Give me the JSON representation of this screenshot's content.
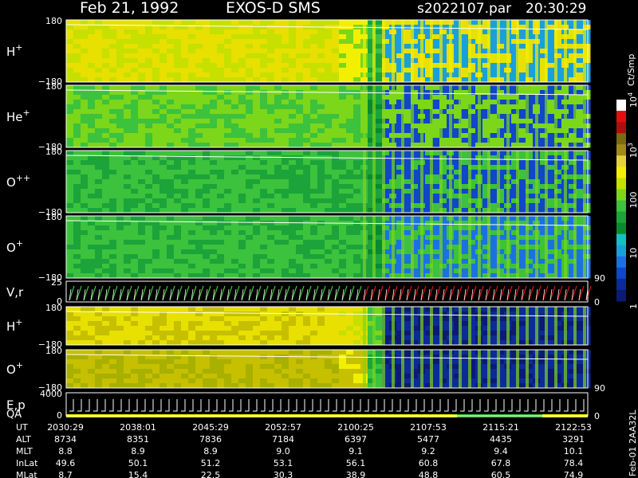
{
  "header": {
    "date": "Feb 21, 1992",
    "instrument": "EXOS-D SMS",
    "file": "s2022107.par",
    "time": "20:30:29"
  },
  "colorbar": {
    "unit_label": "Ct/Smp",
    "ticks": [
      {
        "base": "10",
        "exp": "4",
        "value": 10000
      },
      {
        "base": "10",
        "exp": "3",
        "value": 1000
      },
      {
        "base": "100",
        "exp": "",
        "value": 100
      },
      {
        "base": "10",
        "exp": "",
        "value": 10
      },
      {
        "base": "1",
        "exp": "",
        "value": 1
      }
    ],
    "colors": [
      "#0c1a73",
      "#0d2a99",
      "#1046c8",
      "#1a72e0",
      "#1aa0d8",
      "#16c0c0",
      "#0a8a2e",
      "#1ca43a",
      "#3cc23c",
      "#7cd61a",
      "#c6e000",
      "#f2f000",
      "#e6d040",
      "#a08a1a",
      "#7a6a10",
      "#aa1010",
      "#e01010",
      "#ffffff"
    ]
  },
  "chart_data": {
    "type": "heatmap",
    "panels": [
      {
        "id": "h-plus",
        "label": "H",
        "charge": "+",
        "y_top": "180",
        "y_bottom": "−180",
        "y_range": [
          -180,
          180
        ],
        "right_label": ""
      },
      {
        "id": "he-plus",
        "label": "He",
        "charge": "+",
        "y_top": "180",
        "y_bottom": "−180",
        "y_range": [
          -180,
          180
        ],
        "right_label": ""
      },
      {
        "id": "o-plus-plus",
        "label": "O",
        "charge": "++",
        "y_top": "180",
        "y_bottom": "−180",
        "y_range": [
          -180,
          180
        ],
        "right_label": ""
      },
      {
        "id": "o-plus",
        "label": "O",
        "charge": "+",
        "y_top": "180",
        "y_bottom": "−180",
        "y_range": [
          -180,
          180
        ],
        "right_label": "90"
      },
      {
        "id": "vr",
        "label": "V,r",
        "charge": "",
        "y_top": "25",
        "y_bottom": "0",
        "y_range": [
          0,
          25
        ],
        "right_label": "0"
      },
      {
        "id": "h-plus-2",
        "label": "H",
        "charge": "+",
        "y_top": "180",
        "y_bottom": "−180",
        "y_range": [
          -180,
          180
        ],
        "right_label": ""
      },
      {
        "id": "o-plus-2",
        "label": "O",
        "charge": "+",
        "y_top": "180",
        "y_bottom": "−180",
        "y_range": [
          -180,
          180
        ],
        "right_label": "90"
      },
      {
        "id": "ep-qa",
        "label": "E,p",
        "label2": "QA",
        "charge": "",
        "y_top": "4000",
        "y_bottom": "0",
        "y_range": [
          0,
          4000
        ],
        "right_label": "0"
      }
    ],
    "x_axis": {
      "row_labels": [
        "UT",
        "ALT",
        "MLT",
        "InLat",
        "MLat"
      ],
      "ticks": [
        {
          "UT": "2030:29",
          "ALT": "8734",
          "MLT": "8.8",
          "InLat": "49.6",
          "MLat": "8.7"
        },
        {
          "UT": "2038:01",
          "ALT": "8351",
          "MLT": "8.9",
          "InLat": "50.1",
          "MLat": "15.4"
        },
        {
          "UT": "2045:29",
          "ALT": "7836",
          "MLT": "8.9",
          "InLat": "51.2",
          "MLat": "22.5"
        },
        {
          "UT": "2052:57",
          "ALT": "7184",
          "MLT": "9.0",
          "InLat": "53.1",
          "MLat": "30.3"
        },
        {
          "UT": "2100:25",
          "ALT": "6397",
          "MLT": "9.1",
          "InLat": "56.1",
          "MLat": "38.9"
        },
        {
          "UT": "2107:53",
          "ALT": "5477",
          "MLT": "9.2",
          "InLat": "60.8",
          "MLat": "48.8"
        },
        {
          "UT": "2115:21",
          "ALT": "4435",
          "MLT": "9.4",
          "InLat": "67.8",
          "MLat": "60.5"
        },
        {
          "UT": "2122:53",
          "ALT": "3291",
          "MLT": "10.1",
          "InLat": "78.4",
          "MLat": "74.9"
        }
      ]
    },
    "color_scale": "log",
    "z_range": [
      1,
      10000
    ],
    "z_unit": "Ct/Smp"
  },
  "footer": {
    "rotated_text": "Feb-01 2AA32L"
  }
}
